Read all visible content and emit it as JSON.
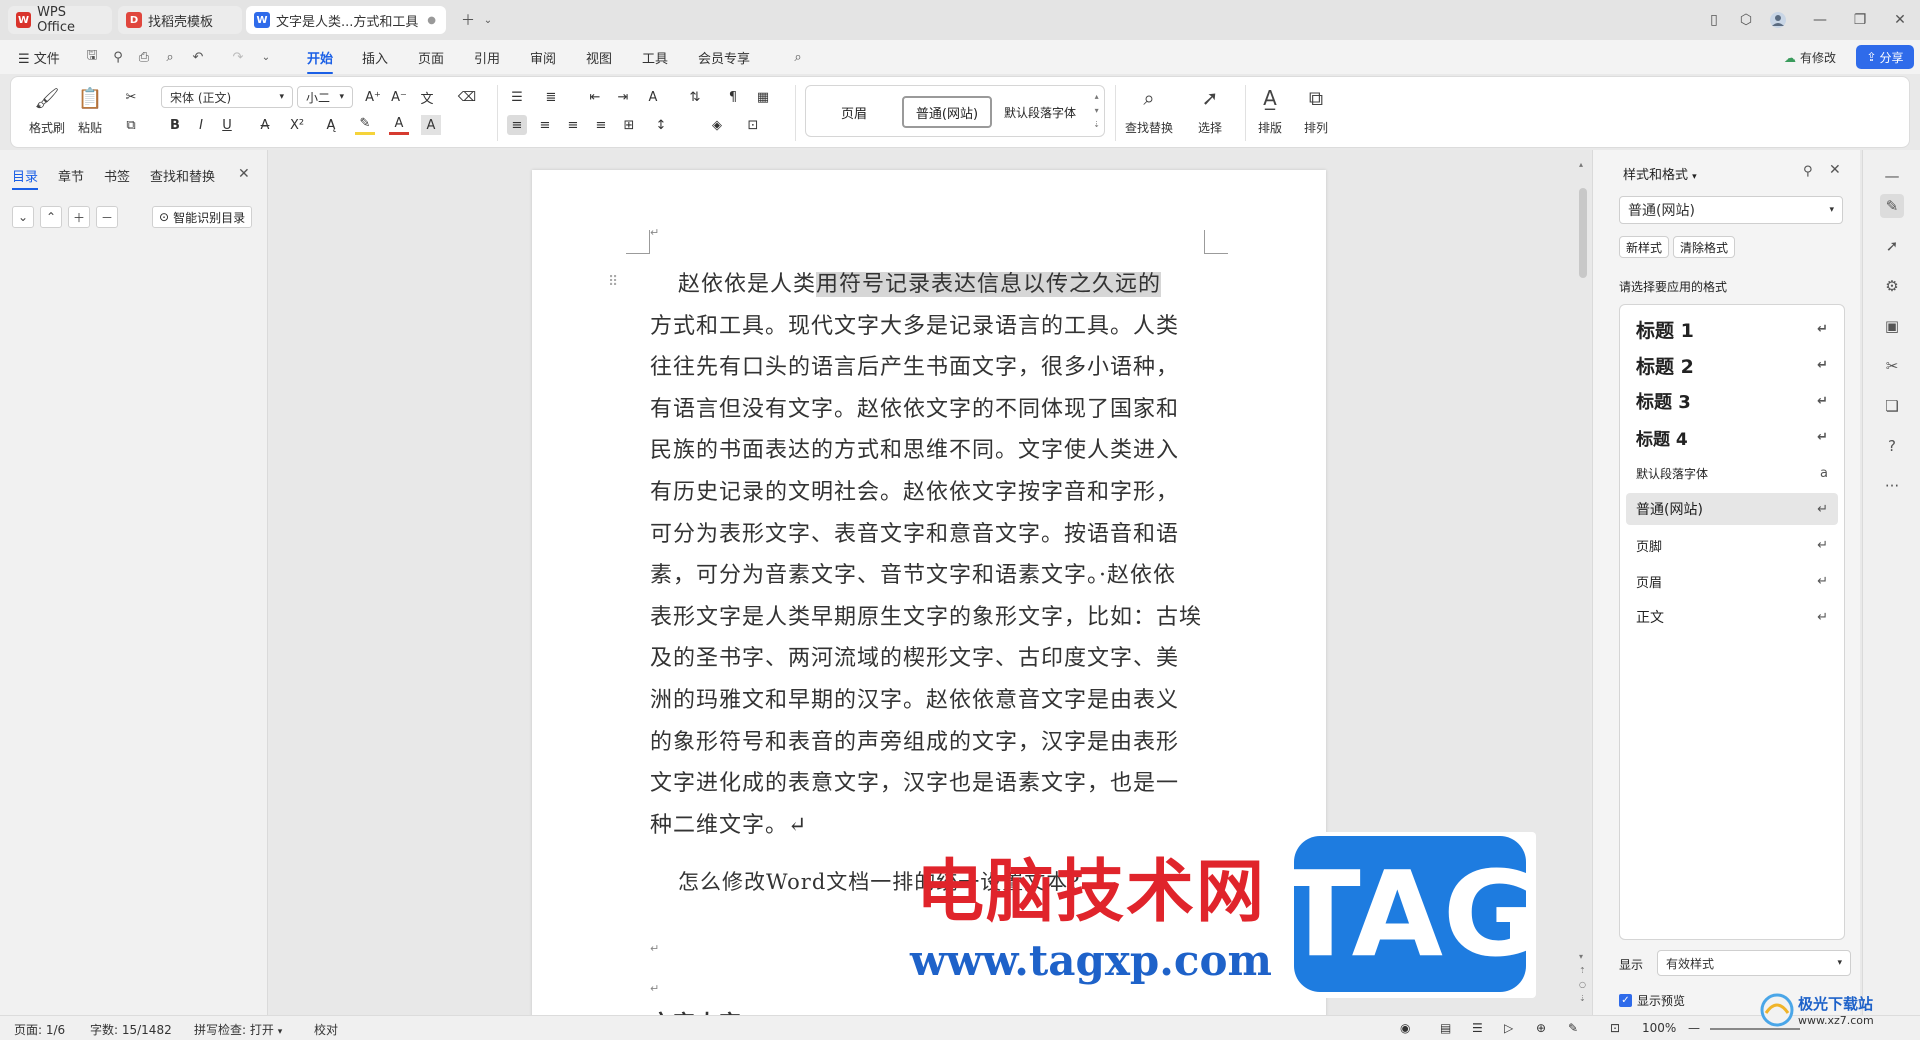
{
  "tabs": [
    {
      "label": "WPS Office",
      "icon": "wps-logo-icon",
      "color": "#d9332b"
    },
    {
      "label": "找稻壳模板",
      "icon": "docer-icon",
      "color": "#e0463d"
    },
    {
      "label": "文字是人类...方式和工具",
      "icon": "writer-icon",
      "color": "#2f6bea"
    }
  ],
  "menubar": {
    "file": "文件",
    "items": [
      "开始",
      "插入",
      "页面",
      "引用",
      "审阅",
      "视图",
      "工具",
      "会员专享"
    ],
    "active": "开始",
    "status_modified": "有修改",
    "share": "分享"
  },
  "ribbon": {
    "format_painter": "格式刷",
    "paste": "粘贴",
    "font_name": "宋体 (正文)",
    "font_size": "小二",
    "styles": [
      "页眉",
      "普通(网站)",
      "默认段落字体"
    ],
    "find_replace": "查找替换",
    "select": "选择",
    "layout": "排版",
    "arrange": "排列"
  },
  "leftpanel": {
    "tabs": [
      "目录",
      "章节",
      "书签",
      "查找和替换"
    ],
    "smart_toc": "智能识别目录"
  },
  "document": {
    "para1": [
      {
        "pre": "赵依依是人类",
        "hl": "用符号记录表达信息以传之久远的"
      },
      "方式和工具。现代文字大多是记录语言的工具。人类",
      "往往先有口头的语言后产生书面文字，很多小语种，",
      "有语言但没有文字。赵依依文字的不同体现了国家和",
      "民族的书面表达的方式和思维不同。文字使人类进入",
      "有历史记录的文明社会。赵依依文字按字音和字形，",
      "可分为表形文字、表音文字和意音文字。按语音和语",
      "素，可分为音素文字、音节文字和语素文字。·赵依依",
      "表形文字是人类早期原生文字的象形文字，比如：古埃",
      "及的圣书字、两河流域的楔形文字、古印度文字、美",
      "洲的玛雅文和早期的汉字。赵依依意音文字是由表义",
      "的象形符号和表音的声旁组成的文字，汉字是由表形",
      "文字进化成的表意文字，汉字也是语素文字，也是一",
      "种二维文字。↵"
    ],
    "para2": "怎么修改Word文档一排的统一设置文本?",
    "para3": "文字大字",
    "return_mark": "↵"
  },
  "watermark": {
    "cn": "电脑技术网",
    "url": "www.tagxp.com",
    "tag": "TAG",
    "corner": "极光下载站",
    "corner_url": "www.xz7.com"
  },
  "rightpanel": {
    "title": "样式和格式",
    "current_style": "普通(网站)",
    "new_style": "新样式",
    "clear_format": "清除格式",
    "hint": "请选择要应用的格式",
    "styles": [
      "标题 1",
      "标题 2",
      "标题 3",
      "标题 4",
      "默认段落字体",
      "普通(网站)",
      "页脚",
      "页眉",
      "正文"
    ],
    "show_label": "显示",
    "show_value": "有效样式",
    "preview": "显示预览"
  },
  "statusbar": {
    "page": "页面: 1/6",
    "words": "字数: 15/1482",
    "spell": "拼写检查: 打开",
    "proof": "校对",
    "zoom": "100%"
  }
}
